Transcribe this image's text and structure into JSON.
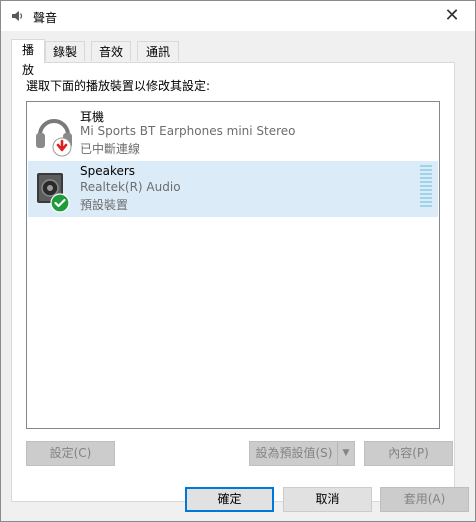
{
  "window": {
    "title": "聲音",
    "close_label": "✕"
  },
  "tabs": [
    {
      "label": "播放",
      "active": true
    },
    {
      "label": "錄製",
      "active": false
    },
    {
      "label": "音效",
      "active": false
    },
    {
      "label": "通訊",
      "active": false
    }
  ],
  "panel": {
    "instruction": "選取下面的播放裝置以修改其設定:"
  },
  "devices": [
    {
      "name": "耳機",
      "driver": "Mi Sports BT Earphones mini Stereo",
      "status": "已中斷連線",
      "icon": "headphones-icon",
      "badge": "disconnected-arrow-icon",
      "selected": false
    },
    {
      "name": "Speakers",
      "driver": "Realtek(R) Audio",
      "status": "預設裝置",
      "icon": "speaker-icon",
      "badge": "default-checkmark-icon",
      "selected": true
    }
  ],
  "panel_buttons": {
    "configure": "設定(C)",
    "set_default": "設為預設值(S)",
    "properties": "內容(P)"
  },
  "dialog_buttons": {
    "ok": "確定",
    "cancel": "取消",
    "apply": "套用(A)"
  },
  "colors": {
    "selection": "#dcebf8",
    "accent": "#0078d7",
    "check_green": "#1e9b3c",
    "disconnected_red": "#e02020",
    "meter": "#9fd3ea"
  }
}
